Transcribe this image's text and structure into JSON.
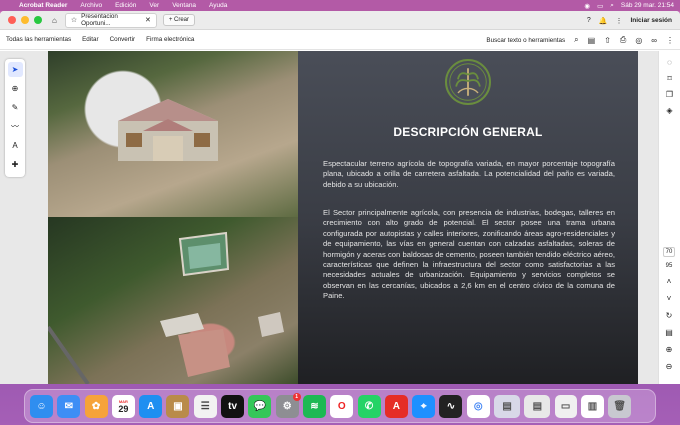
{
  "menubar": {
    "app": "Acrobat Reader",
    "items": [
      "Archivo",
      "Edición",
      "Ver",
      "Ventana",
      "Ayuda"
    ],
    "datetime": "Sáb 29 mar.  21:54"
  },
  "titlebar": {
    "tab_title": "Presentacion Oportuni...",
    "new_label": "Crear",
    "signin": "Iniciar sesión"
  },
  "toolbar": {
    "items": [
      "Todas las herramientas",
      "Editar",
      "Convertir",
      "Firma electrónica"
    ],
    "search_label": "Buscar texto o herramientas"
  },
  "document": {
    "heading": "DESCRIPCIÓN GENERAL",
    "paragraph1": "Espectacular terreno agrícola de topografía variada, en mayor porcentaje topografía plana, ubicado a orilla de carretera asfaltada. La potencialidad del paño es variada, debido a su ubicación.",
    "paragraph2": "El Sector principalmente agrícola, con presencia de industrias, bodegas, talleres en crecimiento con alto grado de potencial. El sector posee una trama urbana configurada por autopistas y calles interiores, zonificando áreas agro-residenciales y de equipamiento, las vías en general cuentan con calzadas asfaltadas, soleras de hormigón y aceras con baldosas de cemento, poseen también tendido eléctrico aéreo, características que definen la infraestructura del sector como satisfactorias a las necesidades actuales de urbanización. Equipamiento y servicios completos se observan en las cercanías, ubicados a 2,6 km en el centro cívico de la comuna de Paine."
  },
  "pagecontrols": {
    "page_number": "70",
    "total_pages": "95"
  },
  "dock": {
    "calendar_month": "MAR",
    "calendar_day": "29",
    "badge_count": "1"
  },
  "colors": {
    "accent": "#1a4fd8",
    "doc_dark": "#3a3d45",
    "dock_bg": "#c76bb4"
  }
}
